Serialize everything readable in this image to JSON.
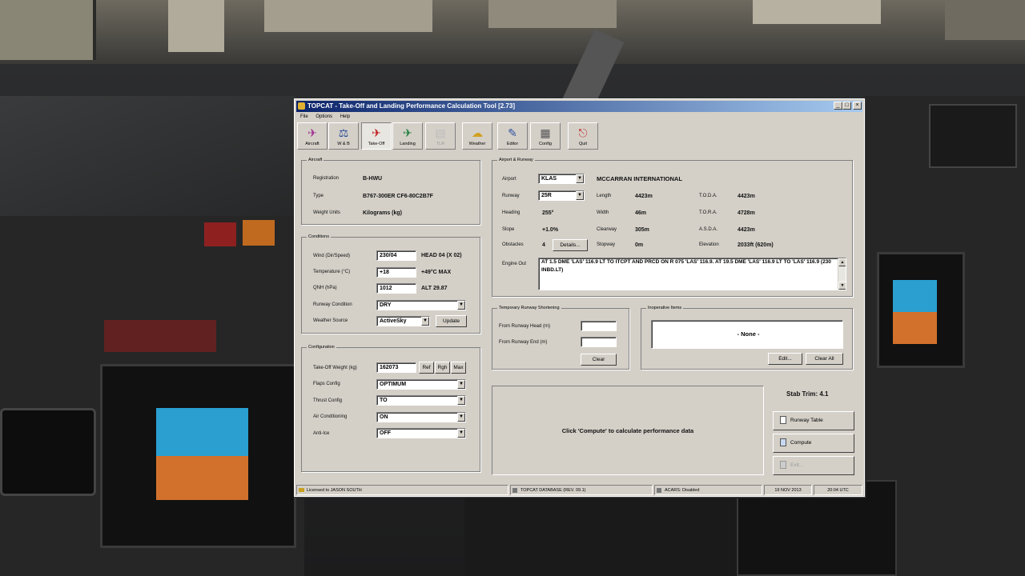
{
  "window": {
    "title": "TOPCAT - Take-Off and Landing Performance Calculation Tool [2.73]"
  },
  "menu": [
    "File",
    "Options",
    "Help"
  ],
  "toolbar": [
    {
      "label": "Aircraft",
      "icon": "aircraft-icon"
    },
    {
      "label": "W & B",
      "icon": "weight-balance-icon"
    },
    {
      "label": "Take-Off",
      "icon": "takeoff-icon"
    },
    {
      "label": "Landing",
      "icon": "landing-icon"
    },
    {
      "label": "TLR",
      "icon": "tlr-icon"
    },
    {
      "label": "Weather",
      "icon": "weather-icon"
    },
    {
      "label": "Editor",
      "icon": "editor-icon"
    },
    {
      "label": "Config",
      "icon": "config-icon"
    },
    {
      "label": "Quit",
      "icon": "quit-icon"
    }
  ],
  "aircraft": {
    "group_label": "Aircraft",
    "registration_label": "Registration",
    "registration": "B-HWU",
    "type_label": "Type",
    "type": "B767-300ER CF6-80C2B7F",
    "units_label": "Weight Units",
    "units": "Kilograms (kg)"
  },
  "conditions": {
    "group_label": "Conditions",
    "wind_label": "Wind (Dir/Speed)",
    "wind": "230/04",
    "wind_info": "HEAD 04 (X 02)",
    "temp_label": "Temperature (°C)",
    "temp": "+18",
    "temp_info": "+49°C MAX",
    "qnh_label": "QNH (hPa)",
    "qnh": "1012",
    "qnh_info": "ALT 29.87",
    "rwycond_label": "Runway Condition",
    "rwycond": "DRY",
    "wx_label": "Weather Source",
    "wx": "ActiveSky",
    "update": "Update"
  },
  "config": {
    "group_label": "Configuration",
    "tow_label": "Take-Off Weight (kg)",
    "tow": "162073",
    "opt1": "Ref",
    "opt2": "Rgh",
    "opt3": "Max",
    "flaps_label": "Flaps Config",
    "flaps": "OPTIMUM",
    "thrust_label": "Thrust Config",
    "thrust": "TO",
    "ac_label": "Air Conditioning",
    "ac": "ON",
    "ai_label": "Anti-Ice",
    "ai": "OFF"
  },
  "airport": {
    "group_label": "Airport & Runway",
    "airport_label": "Airport",
    "airport": "KLAS",
    "airport_name": "MCCARRAN INTERNATIONAL",
    "runway_label": "Runway",
    "runway": "25R",
    "heading_label": "Heading",
    "heading": "255°",
    "slope_label": "Slope",
    "slope": "+1.0%",
    "obst_label": "Obstacles",
    "obst": "4",
    "details": "Details...",
    "length_label": "Length",
    "length": "4423m",
    "width_label": "Width",
    "width": "46m",
    "clearway_label": "Clearway",
    "clearway": "305m",
    "stopway_label": "Stopway",
    "stopway": "0m",
    "toda_label": "T.O.D.A.",
    "toda": "4423m",
    "tora_label": "T.O.R.A.",
    "tora": "4728m",
    "asda_label": "A.S.D.A.",
    "asda": "4423m",
    "elev_label": "Elevation",
    "elev": "2033ft (620m)",
    "eng_label": "Engine Out",
    "eng_text": "AT 1.5 DME 'LAS' 116.9 LT TO ITCPT AND PRCD ON R 075 'LAS' 116.9. AT 19.5 DME 'LAS' 116.9 LT TO 'LAS' 116.9 (230 INBD.LT)"
  },
  "shortening": {
    "group_label": "Temporary Runway Shortening",
    "head_label": "From Runway Head (m)",
    "end_label": "From Runway End (m)",
    "clear": "Clear"
  },
  "inop": {
    "group_label": "Inoperative Items",
    "none": "- None -",
    "edit": "Edit...",
    "clear_all": "Clear All"
  },
  "result": {
    "message": "Click 'Compute' to calculate performance data",
    "stab_trim": "Stab Trim:  4.1"
  },
  "actions": {
    "runway_table": "Runway Table",
    "compute": "Compute",
    "exit": "Exit..."
  },
  "statusbar": {
    "license": "Licensed to JASON SOUTH",
    "database": "TOPCAT DATABASE (REV. 09.1)",
    "acars": "ACARS: Disabled",
    "date": "19 NOV 2013",
    "time": "20:04 UTC"
  }
}
